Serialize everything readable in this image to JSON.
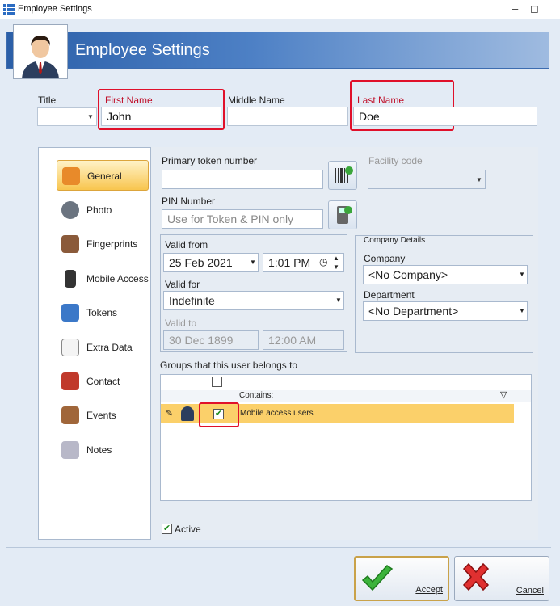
{
  "window": {
    "title": "Employee Settings",
    "minimize": "–",
    "maximize": "◻"
  },
  "header": {
    "title": "Employee Settings"
  },
  "name_fields": {
    "title_label": "Title",
    "first_name_label": "First Name",
    "first_name_value": "John",
    "middle_name_label": "Middle Name",
    "middle_name_value": "",
    "last_name_label": "Last Name",
    "last_name_value": "Doe"
  },
  "nav": {
    "items": [
      {
        "label": "General",
        "icon": "users-icon"
      },
      {
        "label": "Photo",
        "icon": "webcam-icon"
      },
      {
        "label": "Fingerprints",
        "icon": "fingerprint-icon"
      },
      {
        "label": "Mobile Access",
        "icon": "phone-icon"
      },
      {
        "label": "Tokens",
        "icon": "id-card-icon"
      },
      {
        "label": "Extra Data",
        "icon": "clipboard-icon"
      },
      {
        "label": "Contact",
        "icon": "house-icon"
      },
      {
        "label": "Events",
        "icon": "cake-icon"
      },
      {
        "label": "Notes",
        "icon": "notes-icon"
      }
    ]
  },
  "general": {
    "primary_token_label": "Primary token number",
    "primary_token_value": "",
    "facility_code_label": "Facility code",
    "pin_label": "PIN Number",
    "pin_placeholder": "Use for Token & PIN only",
    "valid_from_label": "Valid from",
    "valid_from_date": "25 Feb 2021",
    "valid_from_time": "1:01 PM",
    "valid_for_label": "Valid for",
    "valid_for_value": "Indefinite",
    "valid_to_label": "Valid to",
    "valid_to_date": "30 Dec 1899",
    "valid_to_time": "12:00 AM",
    "company_details_label": "Company Details",
    "company_label": "Company",
    "company_value": "<No Company>",
    "department_label": "Department",
    "department_value": "<No Department>",
    "groups_label": "Groups that this user belongs to",
    "groups_filter_label": "Contains:",
    "groups": [
      {
        "name": "Mobile access users",
        "checked": true
      }
    ],
    "active_label": "Active",
    "active_checked": true
  },
  "buttons": {
    "accept": "Accept",
    "cancel": "Cancel"
  },
  "colors": {
    "accent_red": "#e0102a",
    "selected": "#f8c54e",
    "banner": "#2b5fa8"
  }
}
